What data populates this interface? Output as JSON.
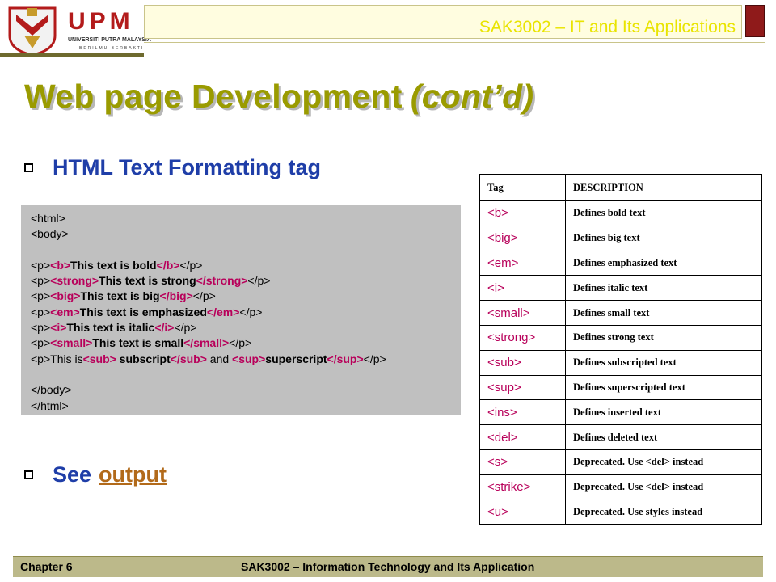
{
  "header": {
    "logo_text": "UPM",
    "logo_subtitle": "UNIVERSITI PUTRA MALAYSIA",
    "logo_motto": "BERILMU BERBAKTI",
    "course_title": "SAK3002 – IT and Its Applications"
  },
  "slide": {
    "title_main": "Web page Development",
    "title_sub": "(cont’d)",
    "bullet1": "HTML Text Formatting tag",
    "bullet2_prefix": "See",
    "bullet2_link": "output"
  },
  "code": {
    "lines": [
      [
        {
          "t": "<html>",
          "k": "plain"
        }
      ],
      [
        {
          "t": "<body>",
          "k": "plain"
        }
      ],
      [],
      [
        {
          "t": "<p>",
          "k": "plain"
        },
        {
          "t": "<b>",
          "k": "tag"
        },
        {
          "t": "This text is bold",
          "k": "bold"
        },
        {
          "t": "</b>",
          "k": "tag"
        },
        {
          "t": "</p>",
          "k": "plain"
        }
      ],
      [
        {
          "t": "<p>",
          "k": "plain"
        },
        {
          "t": "<strong>",
          "k": "tag"
        },
        {
          "t": "This text is strong",
          "k": "bold"
        },
        {
          "t": "</strong>",
          "k": "tag"
        },
        {
          "t": "</p>",
          "k": "plain"
        }
      ],
      [
        {
          "t": "<p>",
          "k": "plain"
        },
        {
          "t": "<big>",
          "k": "tag"
        },
        {
          "t": "This text is big",
          "k": "bold"
        },
        {
          "t": "</big>",
          "k": "tag"
        },
        {
          "t": "</p>",
          "k": "plain"
        }
      ],
      [
        {
          "t": "<p>",
          "k": "plain"
        },
        {
          "t": "<em>",
          "k": "tag"
        },
        {
          "t": "This text is emphasized",
          "k": "bold"
        },
        {
          "t": "</em>",
          "k": "tag"
        },
        {
          "t": "</p>",
          "k": "plain"
        }
      ],
      [
        {
          "t": "<p>",
          "k": "plain"
        },
        {
          "t": "<i>",
          "k": "tag"
        },
        {
          "t": "This text is italic",
          "k": "bold"
        },
        {
          "t": "</i>",
          "k": "tag"
        },
        {
          "t": "</p>",
          "k": "plain"
        }
      ],
      [
        {
          "t": "<p>",
          "k": "plain"
        },
        {
          "t": "<small>",
          "k": "tag"
        },
        {
          "t": "This text is small",
          "k": "bold"
        },
        {
          "t": "</small>",
          "k": "tag"
        },
        {
          "t": "</p>",
          "k": "plain"
        }
      ],
      [
        {
          "t": "<p>",
          "k": "plain"
        },
        {
          "t": "This is",
          "k": "plain"
        },
        {
          "t": "<sub>",
          "k": "tag"
        },
        {
          "t": " subscript",
          "k": "bold"
        },
        {
          "t": "</sub>",
          "k": "tag"
        },
        {
          "t": " and ",
          "k": "plain"
        },
        {
          "t": "<sup>",
          "k": "tag"
        },
        {
          "t": "superscript",
          "k": "bold"
        },
        {
          "t": "</sup>",
          "k": "tag"
        },
        {
          "t": "</p>",
          "k": "plain"
        }
      ],
      [],
      [
        {
          "t": "</body>",
          "k": "plain"
        }
      ],
      [
        {
          "t": "</html>",
          "k": "plain"
        }
      ]
    ]
  },
  "table": {
    "header": [
      "Tag",
      "DESCRIPTION"
    ],
    "rows": [
      [
        "<b>",
        "Defines bold text"
      ],
      [
        "<big>",
        "Defines big text"
      ],
      [
        "<em>",
        "Defines emphasized text"
      ],
      [
        "<i>",
        "Defines italic text"
      ],
      [
        "<small>",
        "Defines small text"
      ],
      [
        "<strong>",
        "Defines strong text"
      ],
      [
        "<sub>",
        "Defines subscripted text"
      ],
      [
        "<sup>",
        "Defines superscripted text"
      ],
      [
        "<ins>",
        "Defines inserted text"
      ],
      [
        "<del>",
        "Defines deleted text"
      ],
      [
        "<s>",
        "Deprecated. Use <del> instead"
      ],
      [
        "<strike>",
        "Deprecated. Use <del> instead"
      ],
      [
        "<u>",
        "Deprecated. Use styles instead"
      ]
    ]
  },
  "footer": {
    "chapter": "Chapter 6",
    "course": "SAK3002 – Information Technology and Its Application"
  },
  "colors": {
    "title": "#9a9b00",
    "bullet": "#1f3ea8",
    "link": "#b26a1a",
    "tag": "#b8005a",
    "footer_bg": "#bcb98a"
  }
}
